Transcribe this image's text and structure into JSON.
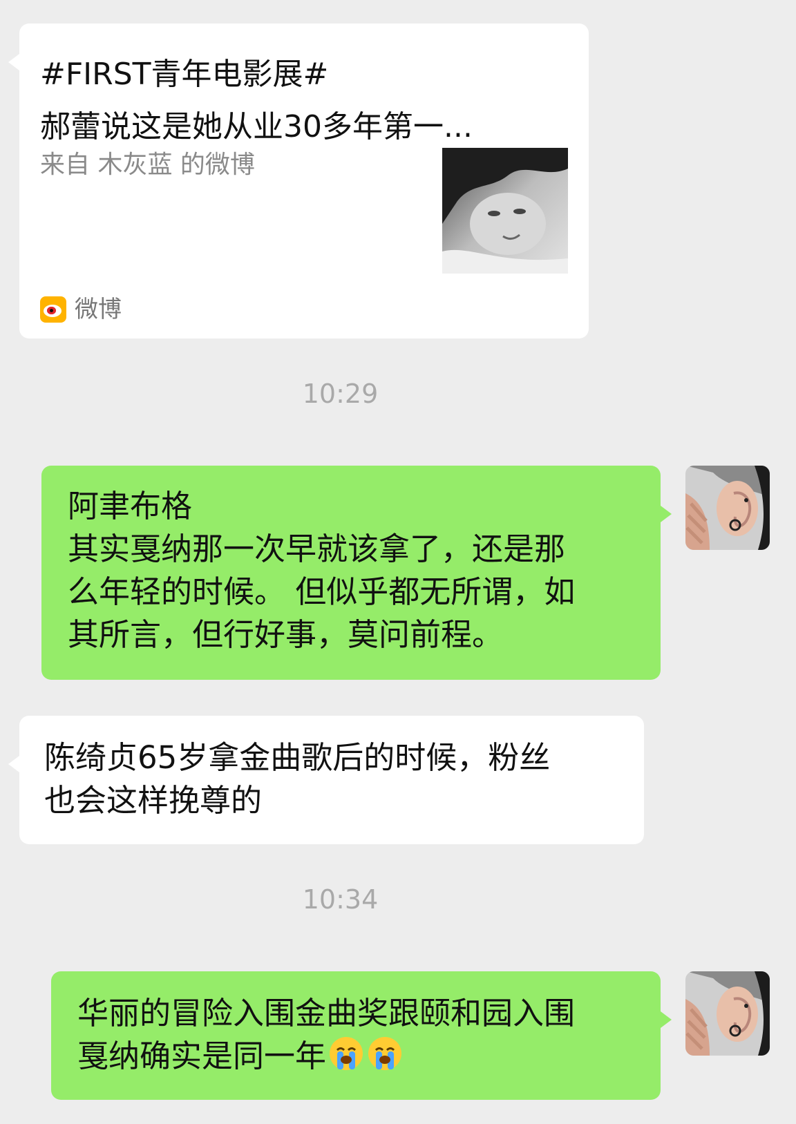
{
  "link_card": {
    "title_line1": "#FIRST青年电影展#",
    "title_line2": "郝蕾说这是她从业30多年第一...",
    "source": "来自 木灰蓝 的微博",
    "app_name": "微博",
    "app_icon": "weibo-icon"
  },
  "timestamps": {
    "first": "10:29",
    "second": "10:34"
  },
  "messages": [
    {
      "direction": "sent",
      "lines": [
        "阿聿布格",
        "其实戛纳那一次早就该拿了，还是那",
        "么年轻的时候。 但似乎都无所谓，如",
        "其所言，但行好事，莫问前程。"
      ]
    },
    {
      "direction": "received",
      "lines": [
        "陈绮贞65岁拿金曲歌后的时候，粉丝",
        "也会这样挽尊的"
      ]
    },
    {
      "direction": "sent",
      "lines": [
        "华丽的冒险入围金曲奖跟颐和园入围",
        "戛纳确实是同一年"
      ],
      "emoji": [
        "loudly-crying-face",
        "loudly-crying-face"
      ]
    }
  ],
  "colors": {
    "background": "#ededed",
    "sent_bubble": "#95ec69",
    "received_bubble": "#ffffff",
    "timestamp": "#a9a9a9"
  }
}
